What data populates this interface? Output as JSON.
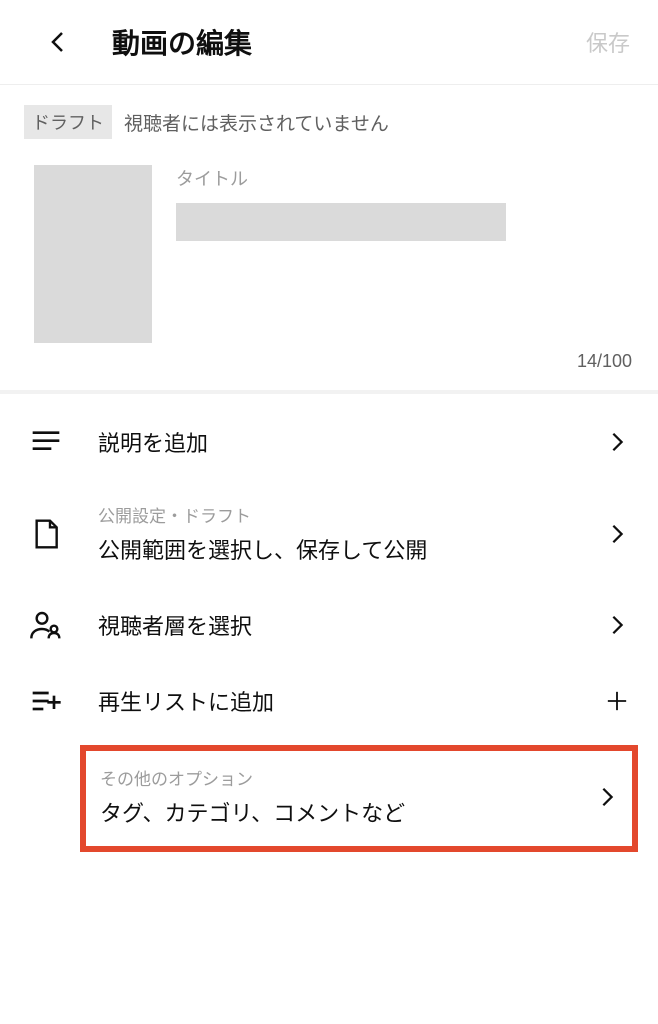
{
  "header": {
    "title": "動画の編集",
    "save": "保存"
  },
  "status": {
    "badge": "ドラフト",
    "text": "視聴者には表示されていません"
  },
  "titleSection": {
    "label": "タイトル",
    "counter": "14/100"
  },
  "menu": {
    "addDescription": "説明を追加",
    "publish": {
      "small": "公開設定・ドラフト",
      "main": "公開範囲を選択し、保存して公開"
    },
    "audience": "視聴者層を選択",
    "playlist": "再生リストに追加",
    "other": {
      "small": "その他のオプション",
      "main": "タグ、カテゴリ、コメントなど"
    }
  }
}
